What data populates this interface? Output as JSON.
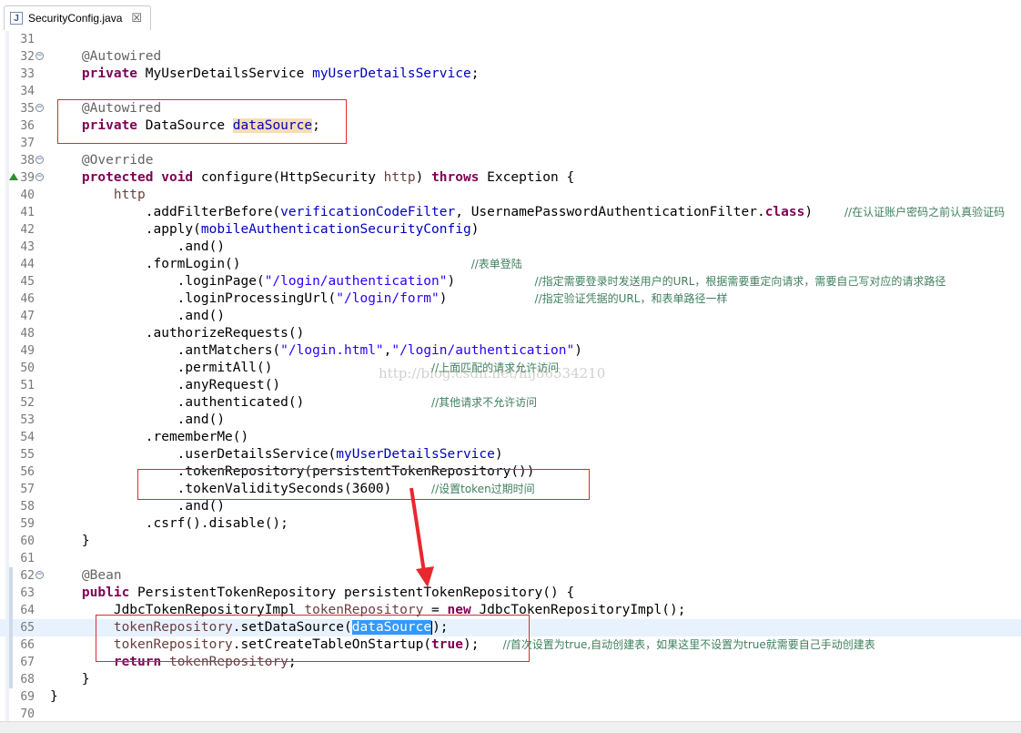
{
  "tab": {
    "filename": "SecurityConfig.java",
    "close_label": "☒",
    "file_icon": "J"
  },
  "watermark": "http://blog.csdn.net/mj86534210",
  "colors": {
    "keyword": "#7f0055",
    "annotation": "#646464",
    "field": "#0000c0",
    "string": "#2a00ff",
    "comment": "#3f7f5f",
    "highlight_box": "#e0282e",
    "selection": "#3399ff"
  },
  "lines": [
    {
      "n": "31",
      "t": []
    },
    {
      "n": "32",
      "fold": true,
      "t": [
        [
          "    ",
          ""
        ],
        [
          "@Autowired",
          "an"
        ]
      ]
    },
    {
      "n": "33",
      "t": [
        [
          "    ",
          ""
        ],
        [
          "private",
          "kw"
        ],
        [
          " MyUserDetailsService ",
          ""
        ],
        [
          "myUserDetailsService",
          "fd"
        ],
        [
          ";",
          ""
        ]
      ]
    },
    {
      "n": "34",
      "t": []
    },
    {
      "n": "35",
      "fold": true,
      "t": [
        [
          "    ",
          ""
        ],
        [
          "@Autowired",
          "an"
        ]
      ]
    },
    {
      "n": "36",
      "t": [
        [
          "    ",
          ""
        ],
        [
          "private",
          "kw"
        ],
        [
          " DataSource ",
          ""
        ],
        [
          "dataSource",
          "fd occ"
        ],
        [
          ";",
          ""
        ]
      ]
    },
    {
      "n": "37",
      "t": []
    },
    {
      "n": "38",
      "fold": true,
      "t": [
        [
          "    ",
          ""
        ],
        [
          "@Override",
          "an"
        ]
      ]
    },
    {
      "n": "39",
      "override": true,
      "fold": true,
      "t": [
        [
          "    ",
          ""
        ],
        [
          "protected",
          "kw"
        ],
        [
          " ",
          ""
        ],
        [
          "void",
          "kw"
        ],
        [
          " configure(HttpSecurity ",
          ""
        ],
        [
          "http",
          "pm"
        ],
        [
          ") ",
          ""
        ],
        [
          "throws",
          "kw"
        ],
        [
          " Exception {",
          ""
        ]
      ]
    },
    {
      "n": "40",
      "t": [
        [
          "        ",
          ""
        ],
        [
          "http",
          "pm"
        ]
      ]
    },
    {
      "n": "41",
      "t": [
        [
          "            .addFilterBefore(",
          ""
        ],
        [
          "verificationCodeFilter",
          "fd"
        ],
        [
          ", UsernamePasswordAuthenticationFilter.",
          ""
        ],
        [
          "class",
          "kw"
        ],
        [
          ")    ",
          ""
        ],
        [
          "//在认证账户密码之前认真验证码",
          "cm"
        ]
      ]
    },
    {
      "n": "42",
      "t": [
        [
          "            .apply(",
          ""
        ],
        [
          "mobileAuthenticationSecurityConfig",
          "fd"
        ],
        [
          ")",
          ""
        ]
      ]
    },
    {
      "n": "43",
      "t": [
        [
          "                .and()",
          ""
        ]
      ]
    },
    {
      "n": "44",
      "t": [
        [
          "            .formLogin()                             ",
          ""
        ],
        [
          "//表单登陆",
          "cm"
        ]
      ]
    },
    {
      "n": "45",
      "t": [
        [
          "                .loginPage(",
          ""
        ],
        [
          "\"/login/authentication\"",
          "st"
        ],
        [
          ")          ",
          ""
        ],
        [
          "//指定需要登录时发送用户的URL，根据需要重定向请求，需要自己写对应的请求路径",
          "cm"
        ]
      ]
    },
    {
      "n": "46",
      "t": [
        [
          "                .loginProcessingUrl(",
          ""
        ],
        [
          "\"/login/form\"",
          "st"
        ],
        [
          ")           ",
          ""
        ],
        [
          "//指定验证凭据的URL，和表单路径一样",
          "cm"
        ]
      ]
    },
    {
      "n": "47",
      "t": [
        [
          "                .and()",
          ""
        ]
      ]
    },
    {
      "n": "48",
      "t": [
        [
          "            .authorizeRequests()",
          ""
        ]
      ]
    },
    {
      "n": "49",
      "t": [
        [
          "                .antMatchers(",
          ""
        ],
        [
          "\"/login.html\"",
          "st"
        ],
        [
          ",",
          ""
        ],
        [
          "\"/login/authentication\"",
          "st"
        ],
        [
          ")",
          ""
        ]
      ]
    },
    {
      "n": "50",
      "t": [
        [
          "                .permitAll()                    ",
          ""
        ],
        [
          "//上面匹配的请求允许访问",
          "cm"
        ]
      ]
    },
    {
      "n": "51",
      "t": [
        [
          "                .anyRequest()",
          ""
        ]
      ]
    },
    {
      "n": "52",
      "t": [
        [
          "                .authenticated()                ",
          ""
        ],
        [
          "//其他请求不允许访问",
          "cm"
        ]
      ]
    },
    {
      "n": "53",
      "t": [
        [
          "                .and()",
          ""
        ]
      ]
    },
    {
      "n": "54",
      "t": [
        [
          "            .rememberMe()",
          ""
        ]
      ]
    },
    {
      "n": "55",
      "t": [
        [
          "                .userDetailsService(",
          ""
        ],
        [
          "myUserDetailsService",
          "fd"
        ],
        [
          ")",
          ""
        ]
      ]
    },
    {
      "n": "56",
      "t": [
        [
          "                .tokenRepository(persistentTokenRepository())",
          ""
        ]
      ]
    },
    {
      "n": "57",
      "t": [
        [
          "                .tokenValiditySeconds(3600)     ",
          ""
        ],
        [
          "//设置token过期时间",
          "cm"
        ]
      ]
    },
    {
      "n": "58",
      "t": [
        [
          "                .and()",
          ""
        ]
      ]
    },
    {
      "n": "59",
      "t": [
        [
          "            .csrf().disable();",
          ""
        ]
      ]
    },
    {
      "n": "60",
      "t": [
        [
          "    }",
          ""
        ]
      ]
    },
    {
      "n": "61",
      "t": []
    },
    {
      "n": "62",
      "mark": true,
      "fold": true,
      "t": [
        [
          "    ",
          ""
        ],
        [
          "@Bean",
          "an"
        ]
      ]
    },
    {
      "n": "63",
      "mark": true,
      "t": [
        [
          "    ",
          ""
        ],
        [
          "public",
          "kw"
        ],
        [
          " PersistentTokenRepository persistentTokenRepository() {",
          ""
        ]
      ]
    },
    {
      "n": "64",
      "mark": true,
      "t": [
        [
          "        JdbcTokenRepositoryImpl ",
          ""
        ],
        [
          "tokenRepository",
          "pm"
        ],
        [
          " = ",
          ""
        ],
        [
          "new",
          "kw"
        ],
        [
          " JdbcTokenRepositoryImpl();",
          ""
        ]
      ]
    },
    {
      "n": "65",
      "mark": true,
      "current": true,
      "t": [
        [
          "        ",
          ""
        ],
        [
          "tokenRepository",
          "pm"
        ],
        [
          ".setDataSource(",
          ""
        ],
        [
          "dataSource",
          "fd sel"
        ],
        [
          "|",
          "caret"
        ],
        [
          ");",
          ""
        ]
      ]
    },
    {
      "n": "66",
      "mark": true,
      "t": [
        [
          "        ",
          ""
        ],
        [
          "tokenRepository",
          "pm"
        ],
        [
          ".setCreateTableOnStartup(",
          ""
        ],
        [
          "true",
          "kw"
        ],
        [
          ");   ",
          ""
        ],
        [
          "//首次设置为true,自动创建表，如果这里不设置为true就需要自己手动创建表",
          "cm"
        ]
      ]
    },
    {
      "n": "67",
      "mark": true,
      "t": [
        [
          "        ",
          ""
        ],
        [
          "return",
          "kw"
        ],
        [
          " ",
          ""
        ],
        [
          "tokenRepository",
          "pm"
        ],
        [
          ";",
          ""
        ]
      ]
    },
    {
      "n": "68",
      "mark": true,
      "t": [
        [
          "    }",
          ""
        ]
      ]
    },
    {
      "n": "69",
      "t": [
        [
          "}",
          ""
        ]
      ]
    },
    {
      "n": "70",
      "t": []
    }
  ]
}
